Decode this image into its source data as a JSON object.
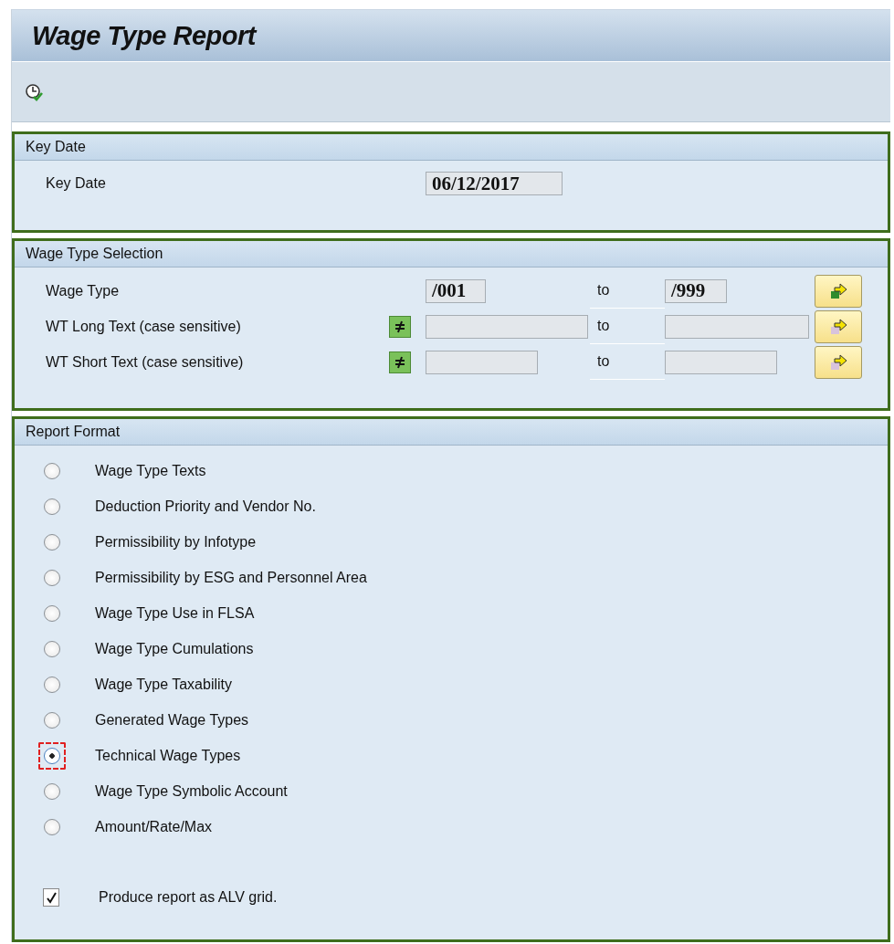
{
  "window": {
    "title": "Wage Type Report"
  },
  "toolbar": {
    "buttons": [
      {
        "kind": "execute"
      }
    ]
  },
  "key_date": {
    "title": "Key Date",
    "label": "Key Date",
    "value": "06/12/2017"
  },
  "wage_type_selection": {
    "title": "Wage Type Selection",
    "rows": [
      {
        "label": "Wage Type",
        "low": "/001",
        "to": "to",
        "high": "/999",
        "selection_options": false,
        "has_values": true
      },
      {
        "label": "WT Long Text (case sensitive)",
        "low": "",
        "to": "to",
        "high": "",
        "selection_options": true,
        "has_values": false
      },
      {
        "label": "WT Short Text (case sensitive)",
        "low": "",
        "to": "to",
        "high": "",
        "selection_options": true,
        "has_values": false
      }
    ]
  },
  "report_format": {
    "title": "Report Format",
    "options": [
      {
        "label": "Wage Type Texts",
        "selected": false,
        "focused": false
      },
      {
        "label": "Deduction Priority and Vendor No.",
        "selected": false,
        "focused": false
      },
      {
        "label": "Permissibility by Infotype",
        "selected": false,
        "focused": false
      },
      {
        "label": "Permissibility by ESG and Personnel Area",
        "selected": false,
        "focused": false
      },
      {
        "label": "Wage Type Use in FLSA",
        "selected": false,
        "focused": false
      },
      {
        "label": "Wage Type Cumulations",
        "selected": false,
        "focused": false
      },
      {
        "label": "Wage Type Taxability",
        "selected": false,
        "focused": false
      },
      {
        "label": "Generated Wage Types",
        "selected": false,
        "focused": false
      },
      {
        "label": "Technical Wage Types",
        "selected": true,
        "focused": true
      },
      {
        "label": "Wage Type Symbolic Account",
        "selected": false,
        "focused": false
      },
      {
        "label": "Amount/Rate/Max",
        "selected": false,
        "focused": false
      }
    ],
    "alv": {
      "label": "Produce report as ALV grid.",
      "checked": true
    }
  }
}
